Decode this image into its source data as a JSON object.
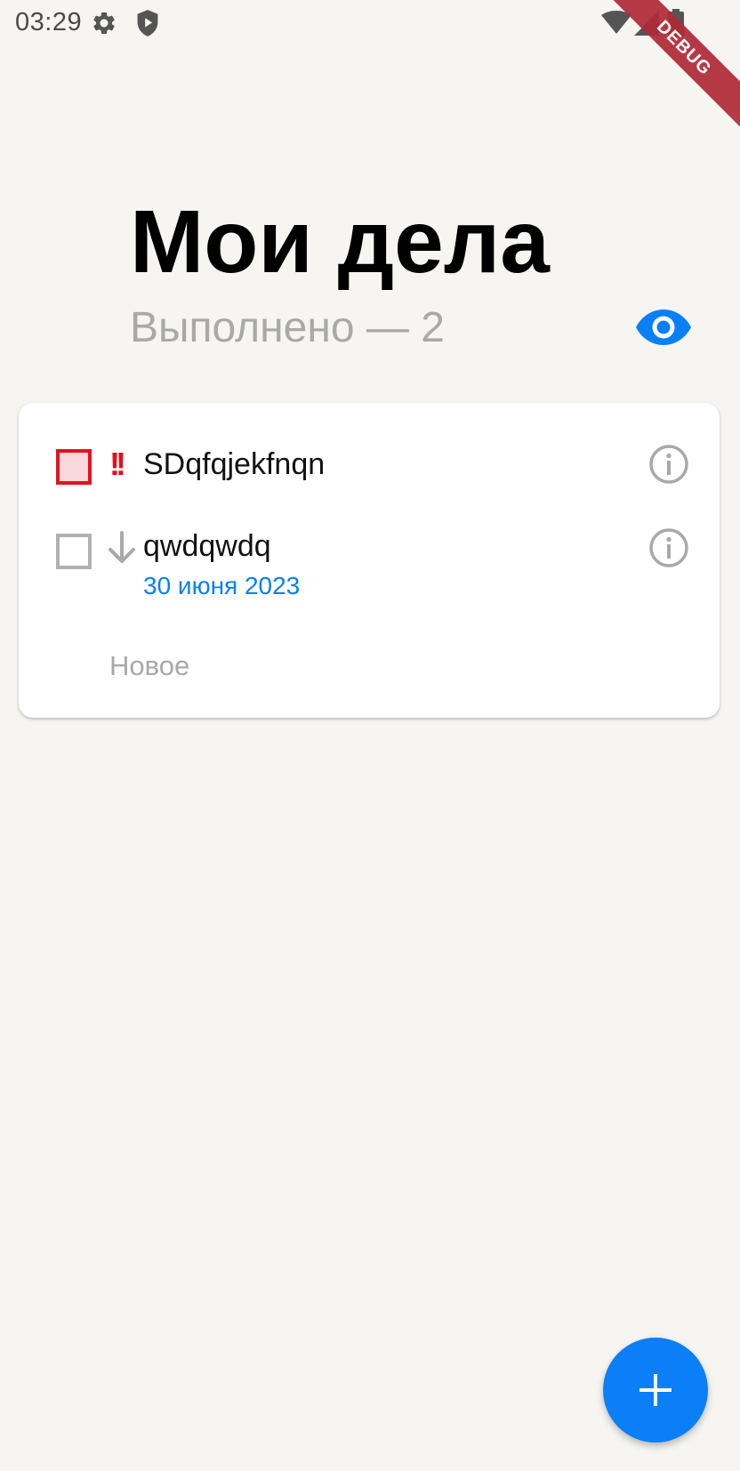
{
  "status_bar": {
    "time": "03:29",
    "icons": [
      "gear-icon",
      "shield-icon",
      "wifi-icon",
      "cellular-signal-icon",
      "battery-icon"
    ]
  },
  "debug_banner": {
    "label": "DEBUG"
  },
  "header": {
    "title": "Мои дела",
    "subtitle": "Выполнено — 2",
    "visibility_icon": "eye-icon"
  },
  "tasks": [
    {
      "priority_symbol": "!!",
      "priority": "high",
      "text": "SDqfqjekfnqn",
      "date": ""
    },
    {
      "priority_symbol": "↓",
      "priority": "low",
      "text": "qwdqwdq",
      "date": "30 июня 2023"
    }
  ],
  "new_task": {
    "label": "Новое"
  },
  "fab": {
    "icon": "plus-icon"
  },
  "colors": {
    "background": "#f6f5f1",
    "accent": "#0a7ff8",
    "high_priority": "#ea0f1e",
    "date_text": "#0a7ff0",
    "muted": "#a9a9a9"
  }
}
